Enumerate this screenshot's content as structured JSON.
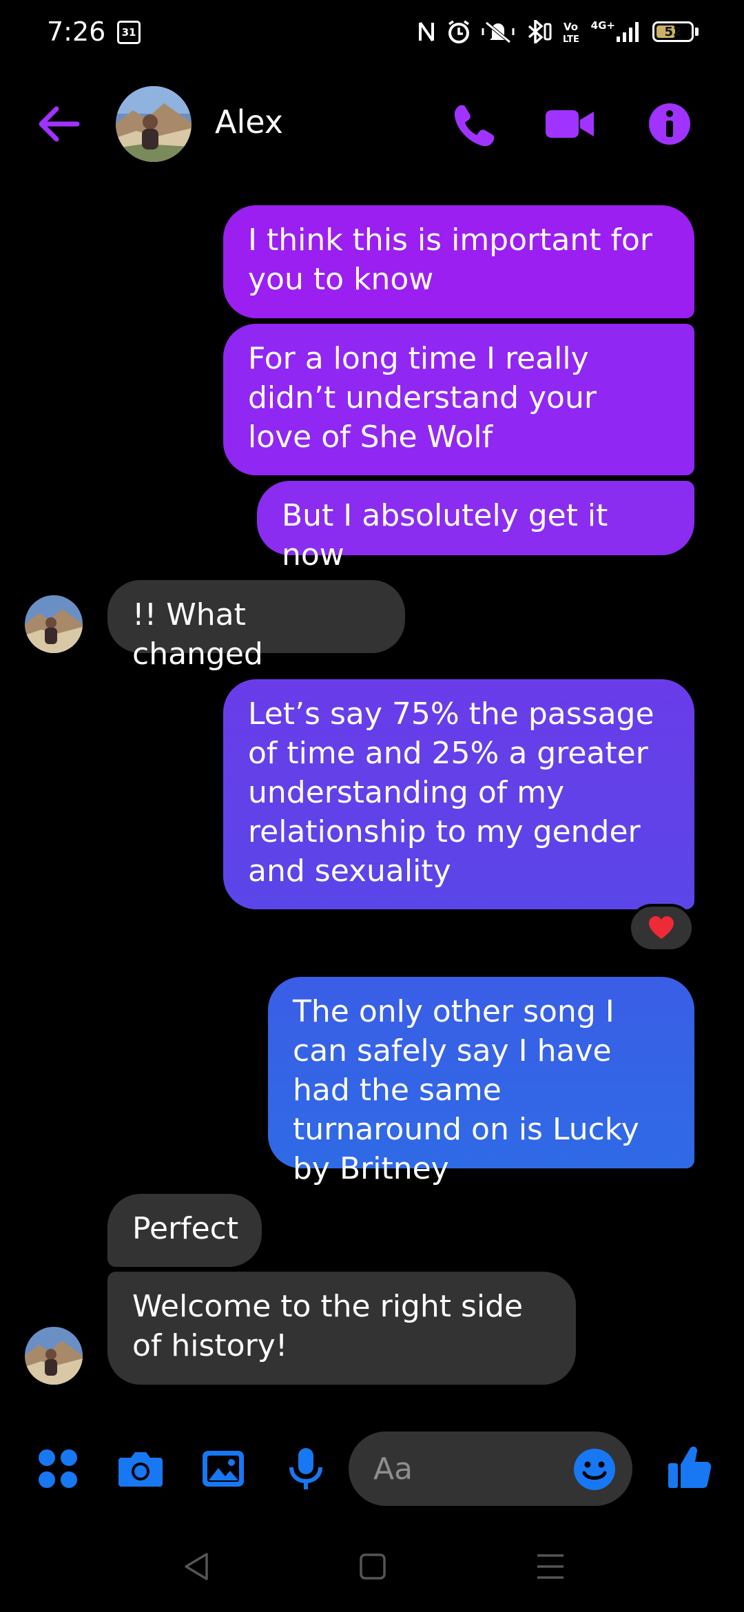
{
  "status_bar": {
    "time": "7:26",
    "calendar_day": "31",
    "network": "4G+",
    "battery": "52",
    "battery_level": 0.52,
    "icons": [
      "nfc-icon",
      "alarm-icon",
      "mute-icon",
      "bluetooth-icon",
      "volte-icon",
      "signal-icon",
      "battery-icon"
    ]
  },
  "header": {
    "contact_name": "Alex",
    "icons": [
      "back-arrow-icon",
      "phone-icon",
      "video-icon",
      "info-icon"
    ]
  },
  "messages": [
    {
      "direction": "outgoing",
      "text": "I think this is important for you to know"
    },
    {
      "direction": "outgoing",
      "text": "For a long time I really didn’t understand your love of She Wolf"
    },
    {
      "direction": "outgoing",
      "text": "But I absolutely get it now"
    },
    {
      "direction": "incoming",
      "text": "!! What changed"
    },
    {
      "direction": "outgoing",
      "text": "Let’s say 75% the passage of time and 25% a greater understanding of my relationship to my gender and sexuality",
      "reaction": "heart"
    },
    {
      "direction": "outgoing",
      "text": "The only other song I can safely say I have had the same turnaround on is Lucky by Britney"
    },
    {
      "direction": "incoming",
      "text": "Perfect"
    },
    {
      "direction": "incoming",
      "text": "Welcome to the right side of history!"
    }
  ],
  "composer": {
    "placeholder": "Aa",
    "value": "",
    "icons": [
      "apps-icon",
      "camera-icon",
      "gallery-icon",
      "microphone-icon",
      "emoji-icon",
      "thumbs-up-icon"
    ]
  },
  "colors": {
    "accent": "#a033ff",
    "messenger_blue": "#1877f2",
    "incoming_bubble": "#333333",
    "gradient": [
      "#9b1ff0",
      "#8b2ff2",
      "#5e45e8",
      "#3069e6"
    ]
  }
}
